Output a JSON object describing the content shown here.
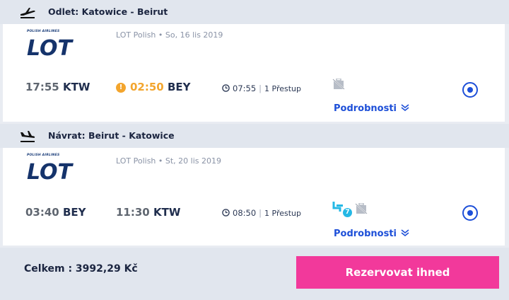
{
  "outbound": {
    "header": "Odlet: Katowice - Beirut",
    "logo_small": "POLISH AIRLINES",
    "logo_text": "LOT",
    "carrier": "LOT Polish • So, 16 lis 2019",
    "depart_time": "17:55",
    "depart_code": "KTW",
    "arrive_time": "02:50",
    "arrive_code": "BEY",
    "warning": "!",
    "duration": "07:55",
    "separator": "|",
    "stops": "1 Přestup",
    "details": "Podrobnosti"
  },
  "return": {
    "header": "Návrat: Beirut - Katowice",
    "logo_small": "POLISH AIRLINES",
    "logo_text": "LOT",
    "carrier": "LOT Polish • St, 20 lis 2019",
    "depart_time": "03:40",
    "depart_code": "BEY",
    "arrive_time": "11:30",
    "arrive_code": "KTW",
    "duration": "08:50",
    "separator": "|",
    "stops": "1 Přestup",
    "seat_badge": "7",
    "details": "Podrobnosti"
  },
  "footer": {
    "total": "Celkem : 3992,29 Kč",
    "cta": "Rezervovat ihned"
  },
  "colors": {
    "accent": "#1d4fd8",
    "cta": "#f2399b",
    "warning": "#f3a52d",
    "seat": "#25b8e5"
  },
  "icons": {
    "departure": "airplane-takeoff-icon",
    "arrival": "airplane-landing-icon",
    "clock": "clock-icon",
    "no_luggage": "no-luggage-icon",
    "seat": "seat-icon",
    "chevron": "double-chevron-down-icon"
  }
}
